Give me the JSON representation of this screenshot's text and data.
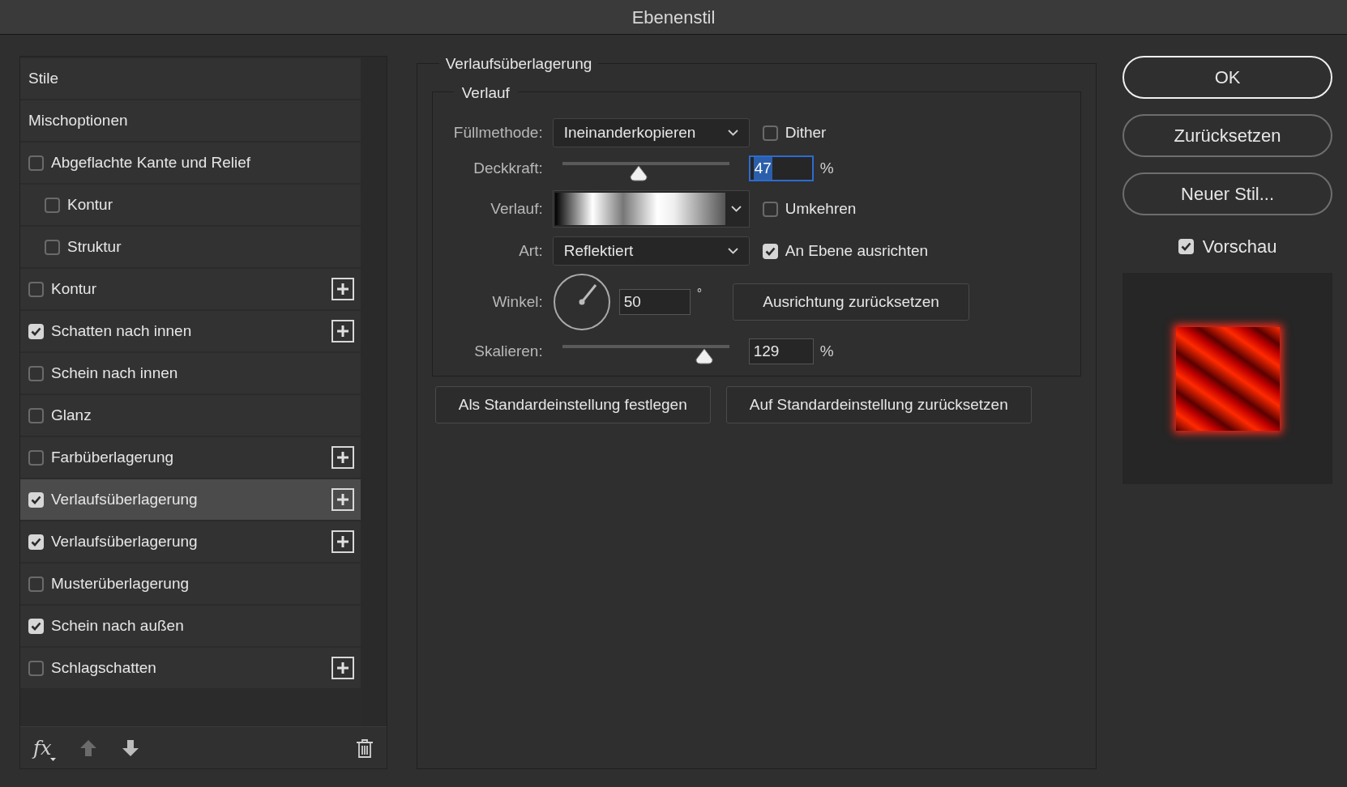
{
  "window": {
    "title": "Ebenenstil"
  },
  "styles_list": {
    "items": [
      {
        "kind": "header",
        "label": "Stile",
        "selected": false
      },
      {
        "kind": "header",
        "label": "Mischoptionen",
        "selected": false
      },
      {
        "kind": "effect",
        "label": "Abgeflachte Kante und Relief",
        "checked": false,
        "selected": false,
        "add_button": false,
        "children": [
          {
            "kind": "effect",
            "label": "Kontur",
            "checked": false,
            "selected": false,
            "add_button": false
          },
          {
            "kind": "effect",
            "label": "Struktur",
            "checked": false,
            "selected": false,
            "add_button": false
          }
        ]
      },
      {
        "kind": "effect",
        "label": "Kontur",
        "checked": false,
        "selected": false,
        "add_button": true
      },
      {
        "kind": "effect",
        "label": "Schatten nach innen",
        "checked": true,
        "selected": false,
        "add_button": true
      },
      {
        "kind": "effect",
        "label": "Schein nach innen",
        "checked": false,
        "selected": false,
        "add_button": false
      },
      {
        "kind": "effect",
        "label": "Glanz",
        "checked": false,
        "selected": false,
        "add_button": false
      },
      {
        "kind": "effect",
        "label": "Farbüberlagerung",
        "checked": false,
        "selected": false,
        "add_button": true
      },
      {
        "kind": "effect",
        "label": "Verlaufsüberlagerung",
        "checked": true,
        "selected": true,
        "add_button": true
      },
      {
        "kind": "effect",
        "label": "Verlaufsüberlagerung",
        "checked": true,
        "selected": false,
        "add_button": true
      },
      {
        "kind": "effect",
        "label": "Musterüberlagerung",
        "checked": false,
        "selected": false,
        "add_button": false
      },
      {
        "kind": "effect",
        "label": "Schein nach außen",
        "checked": true,
        "selected": false,
        "add_button": false
      },
      {
        "kind": "effect",
        "label": "Schlagschatten",
        "checked": false,
        "selected": false,
        "add_button": true
      }
    ],
    "footer": {
      "fx_label": "fx"
    }
  },
  "panel": {
    "title": "Verlaufsüberlagerung",
    "group_title": "Verlauf",
    "blend_mode": {
      "label": "Füllmethode:",
      "value": "Ineinanderkopieren"
    },
    "dither": {
      "label": "Dither",
      "checked": false
    },
    "opacity": {
      "label": "Deckkraft:",
      "level": 0.46,
      "value": "47",
      "unit": "%",
      "focused": true
    },
    "gradient": {
      "label": "Verlauf:"
    },
    "reverse": {
      "label": "Umkehren",
      "checked": false
    },
    "style": {
      "label": "Art:",
      "value": "Reflektiert"
    },
    "align": {
      "label": "An Ebene ausrichten",
      "checked": true
    },
    "angle": {
      "label": "Winkel:",
      "value": "50",
      "unit": "°"
    },
    "reset_alignment": "Ausrichtung zurücksetzen",
    "scale": {
      "label": "Skalieren:",
      "level": 0.85,
      "value": "129",
      "unit": "%",
      "focused": false
    },
    "buttons": [
      "Als Standardeinstellung festlegen",
      "Auf Standardeinstellung zurücksetzen"
    ]
  },
  "actions": [
    {
      "label": "OK",
      "default": true
    },
    {
      "label": "Zurücksetzen",
      "default": false
    },
    {
      "label": "Neuer Stil...",
      "default": false
    }
  ],
  "preview": {
    "label": "Vorschau",
    "checked": true
  }
}
